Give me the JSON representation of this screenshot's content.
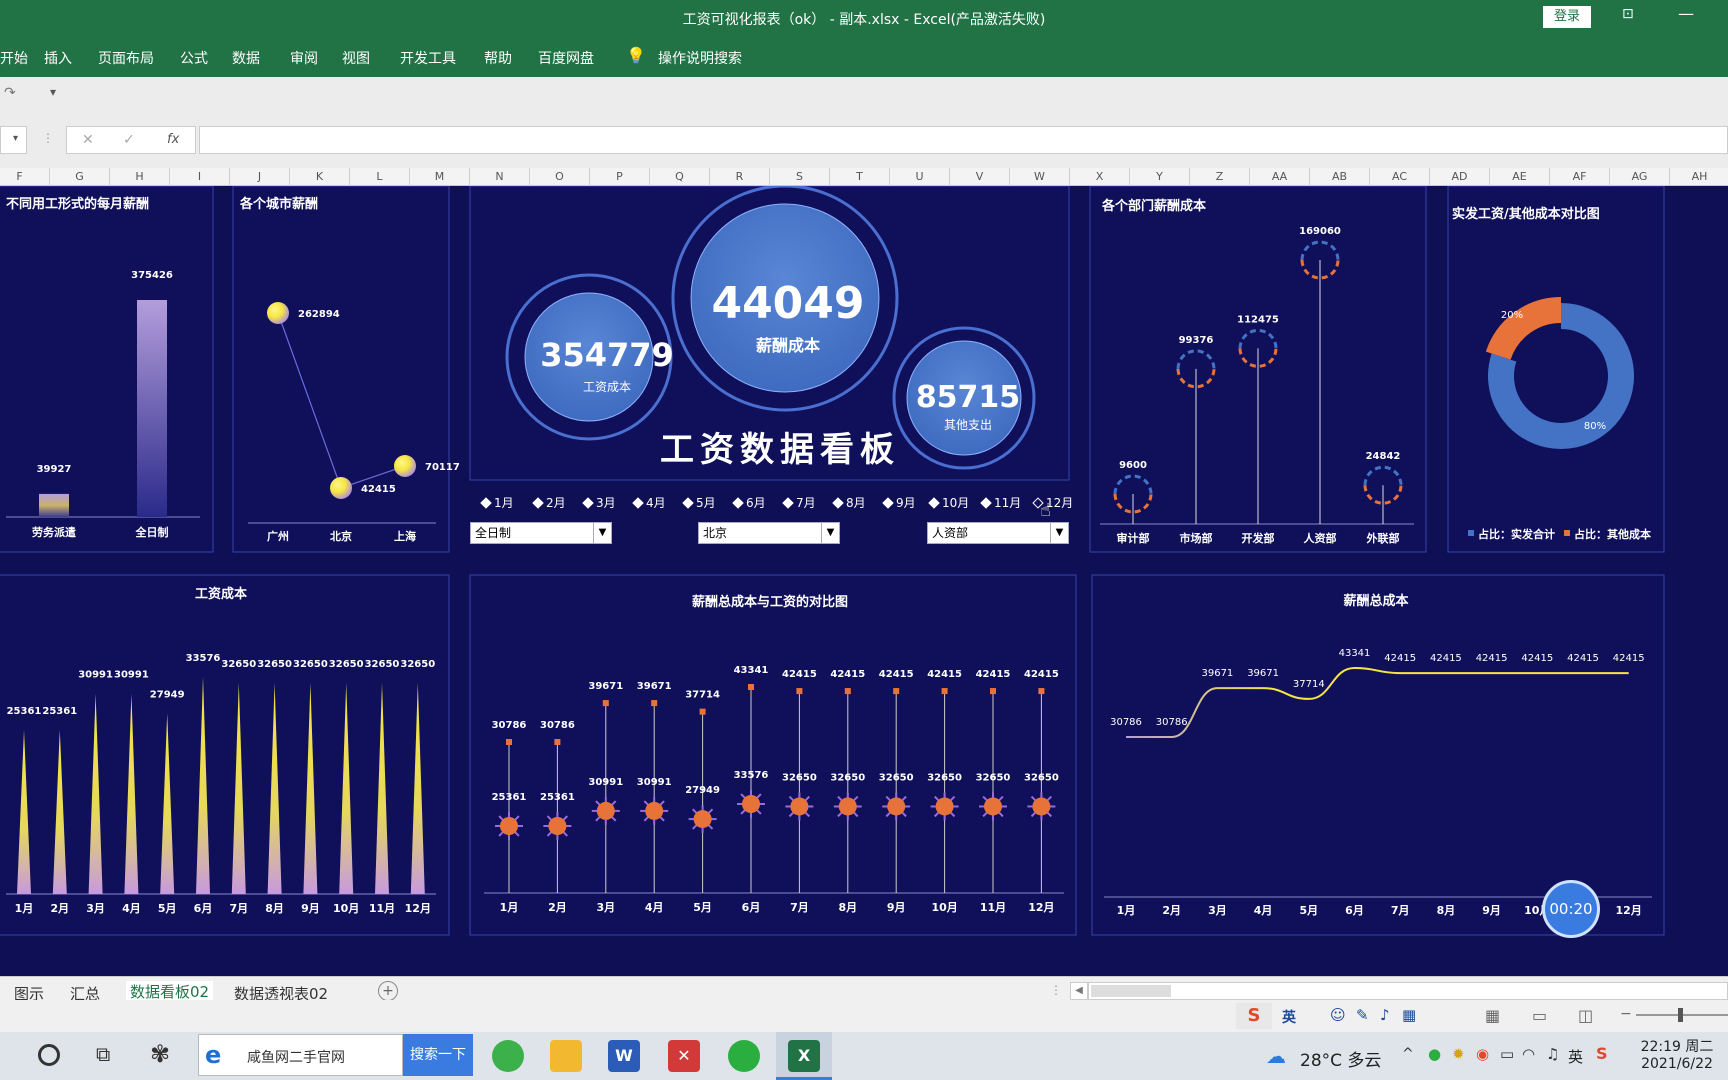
{
  "window": {
    "title": "工资可视化报表（ok） - 副本.xlsx  -  Excel(产品激活失败)",
    "login_label": "登录"
  },
  "ribbon": {
    "tabs": [
      "开始",
      "插入",
      "页面布局",
      "公式",
      "数据",
      "审阅",
      "视图",
      "开发工具",
      "帮助",
      "百度网盘"
    ],
    "search_label": "操作说明搜索"
  },
  "formula_bar": {
    "fx": "fx",
    "cancel": "✕",
    "confirm": "✓",
    "value": ""
  },
  "columns": [
    "F",
    "G",
    "H",
    "I",
    "J",
    "K",
    "L",
    "M",
    "N",
    "O",
    "P",
    "Q",
    "R",
    "S",
    "T",
    "U",
    "V",
    "W",
    "X",
    "Y",
    "Z",
    "AA",
    "AB",
    "AC",
    "AD",
    "AE",
    "AF",
    "AG",
    "AH"
  ],
  "dashboard": {
    "title": "工资数据看板",
    "kpis": {
      "salary_cost": {
        "value": "354779",
        "label": "工资成本"
      },
      "pay_cost": {
        "value": "44049",
        "label": "薪酬成本"
      },
      "other": {
        "value": "85715",
        "label": "其他支出"
      }
    },
    "months": [
      "1月",
      "2月",
      "3月",
      "4月",
      "5月",
      "6月",
      "7月",
      "8月",
      "9月",
      "10月",
      "11月",
      "12月"
    ],
    "selected_month": "12月",
    "filters": {
      "employment": "全日制",
      "city": "北京",
      "dept": "人资部"
    }
  },
  "colors": {
    "bg": "#10105a",
    "orange": "#e8733a",
    "blue": "#4472c4",
    "yellow": "#f5e642",
    "purple": "#b39ddb"
  },
  "panels": {
    "p1_title": "不同用工形式的每月薪酬",
    "p2_title": "各个城市薪酬",
    "p3_title": "各个部门薪酬成本",
    "p4_title": "实发工资/其他成本对比图",
    "p5_title": "工资成本",
    "p6_title": "薪酬总成本与工资的对比图",
    "p7_title": "薪酬总成本"
  },
  "chart_data": [
    {
      "type": "bar",
      "title": "不同用工形式的每月薪酬",
      "categories": [
        "劳务派遣",
        "全日制"
      ],
      "values": [
        39927,
        375426
      ]
    },
    {
      "type": "line",
      "title": "各个城市薪酬",
      "categories": [
        "广州",
        "北京",
        "上海"
      ],
      "values": [
        262894,
        42415,
        70117
      ]
    },
    {
      "type": "bar",
      "title": "各个部门薪酬成本",
      "categories": [
        "审计部",
        "市场部",
        "开发部",
        "人资部",
        "外联部"
      ],
      "values": [
        9600,
        99376,
        112475,
        169060,
        24842
      ]
    },
    {
      "type": "pie",
      "title": "实发工资/其他成本对比图",
      "categories": [
        "占比：实发合计",
        "占比：其他成本"
      ],
      "values": [
        80,
        20
      ],
      "labels": [
        "80%",
        "20%"
      ]
    },
    {
      "type": "bar",
      "title": "工资成本",
      "categories": [
        "1月",
        "2月",
        "3月",
        "4月",
        "5月",
        "6月",
        "7月",
        "8月",
        "9月",
        "10月",
        "11月",
        "12月"
      ],
      "values": [
        25361,
        25361,
        30991,
        30991,
        27949,
        33576,
        32650,
        32650,
        32650,
        32650,
        32650,
        32650
      ]
    },
    {
      "type": "scatter",
      "title": "薪酬总成本与工资的对比图",
      "categories": [
        "1月",
        "2月",
        "3月",
        "4月",
        "5月",
        "6月",
        "7月",
        "8月",
        "9月",
        "10月",
        "11月",
        "12月"
      ],
      "series": [
        {
          "values": [
            30786,
            30786,
            39671,
            39671,
            37714,
            43341,
            42415,
            42415,
            42415,
            42415,
            42415,
            42415
          ]
        },
        {
          "values": [
            25361,
            25361,
            30991,
            30991,
            27949,
            33576,
            32650,
            32650,
            32650,
            32650,
            32650,
            32650
          ]
        }
      ]
    },
    {
      "type": "line",
      "title": "薪酬总成本",
      "categories": [
        "1月",
        "2月",
        "3月",
        "4月",
        "5月",
        "6月",
        "7月",
        "8月",
        "9月",
        "10月",
        "11月",
        "12月"
      ],
      "values": [
        30786,
        30786,
        39671,
        39671,
        37714,
        43341,
        42415,
        42415,
        42415,
        42415,
        42415,
        42415
      ]
    }
  ],
  "timer": "00:20",
  "sheet_tabs": [
    "图示",
    "汇总",
    "数据看板02",
    "数据透视表02"
  ],
  "active_tab": "数据看板02",
  "statusbar": {
    "ime": "英"
  },
  "taskbar": {
    "browser_tab": "咸鱼网二手官网",
    "search_button": "搜索一下",
    "weather": "28°C 多云",
    "time": "22:19 周二",
    "date": "2021/6/22",
    "ime": "英"
  }
}
